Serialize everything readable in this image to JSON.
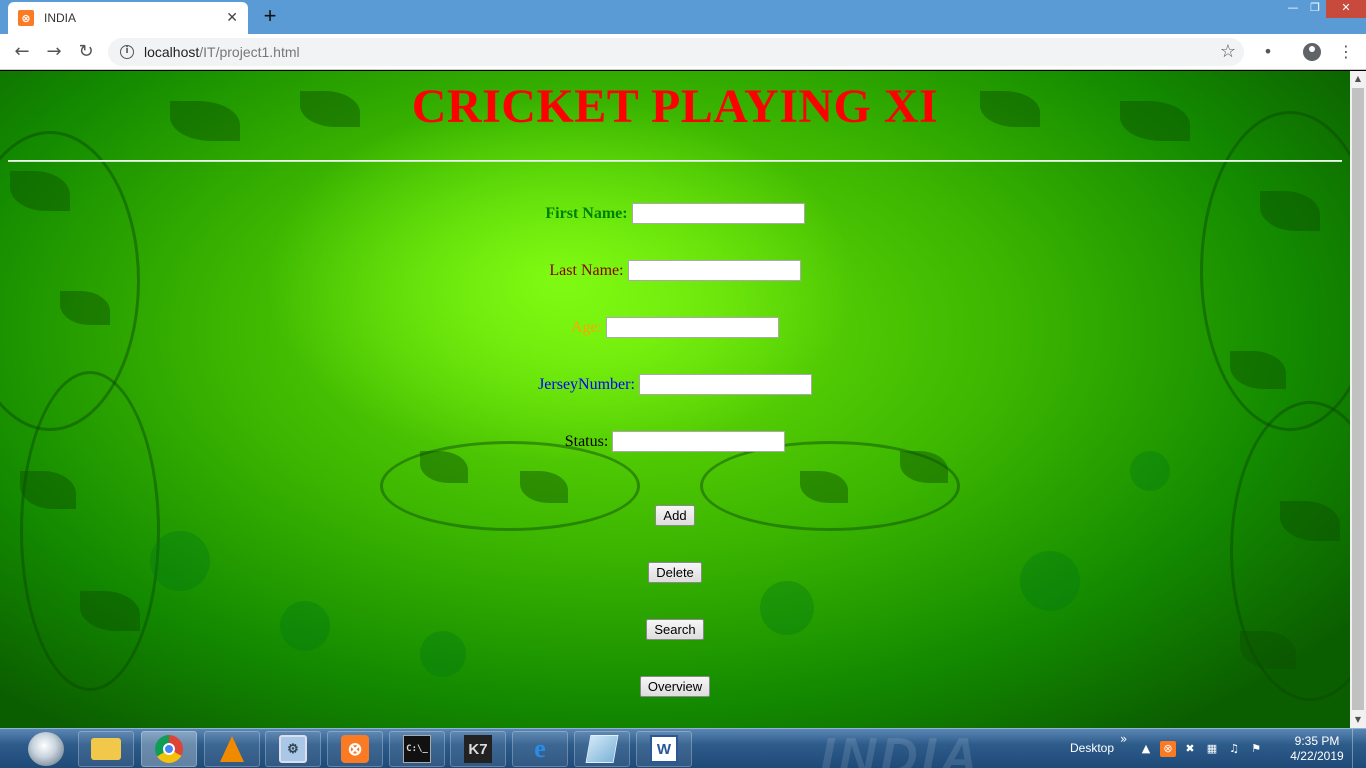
{
  "browser": {
    "tab_title": "INDIA",
    "url_host": "localhost",
    "url_path": "/IT/project1.html"
  },
  "page": {
    "title": "CRICKET PLAYING XI",
    "fields": [
      {
        "label": "First Name:",
        "value": "",
        "color": "#008000",
        "bold": true
      },
      {
        "label": "Last Name:",
        "value": "",
        "color": "#8b0000",
        "bold": false
      },
      {
        "label": "Age:",
        "value": "",
        "color": "#ffa500",
        "bold": false
      },
      {
        "label": "JerseyNumber:",
        "value": "",
        "color": "#0000ff",
        "bold": false
      },
      {
        "label": "Status:",
        "value": "",
        "color": "#000000",
        "bold": false
      }
    ],
    "buttons": {
      "add": "Add",
      "delete": "Delete",
      "search": "Search",
      "overview": "Overview"
    },
    "title_color": "#ff0000"
  },
  "taskbar": {
    "desktop_label": "Desktop",
    "time": "9:35 PM",
    "date": "4/22/2019",
    "watermark": "INDIA",
    "apps": [
      "file-explorer",
      "chrome",
      "vlc",
      "control-panel",
      "xampp",
      "command-prompt",
      "k7",
      "internet-explorer",
      "notepad",
      "word"
    ]
  }
}
